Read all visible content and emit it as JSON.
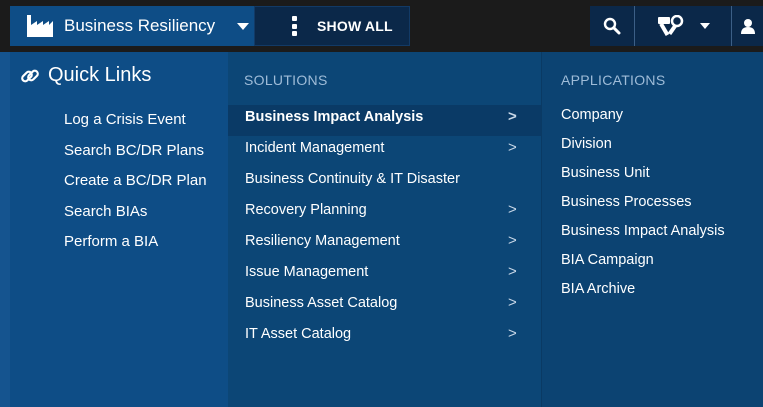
{
  "header": {
    "workspace_title": "Business Resiliency",
    "show_all_label": "SHOW ALL"
  },
  "quick_links": {
    "title": "Quick Links",
    "items": [
      {
        "label": "Log a Crisis Event"
      },
      {
        "label": "Search BC/DR Plans"
      },
      {
        "label": "Create a BC/DR Plan"
      },
      {
        "label": "Search BIAs"
      },
      {
        "label": "Perform a BIA"
      }
    ]
  },
  "solutions": {
    "heading": "SOLUTIONS",
    "items": [
      {
        "label": "Business Impact Analysis",
        "has_submenu": true,
        "active": true
      },
      {
        "label": "Incident Management",
        "has_submenu": true
      },
      {
        "label": "Business Continuity & IT Disaster",
        "has_submenu": false
      },
      {
        "label": "Recovery Planning",
        "has_submenu": true
      },
      {
        "label": "Resiliency Management",
        "has_submenu": true
      },
      {
        "label": "Issue Management",
        "has_submenu": true
      },
      {
        "label": "Business Asset Catalog",
        "has_submenu": true
      },
      {
        "label": "IT Asset Catalog",
        "has_submenu": true
      }
    ],
    "chevron": ">"
  },
  "applications": {
    "heading": "APPLICATIONS",
    "items": [
      {
        "label": "Company"
      },
      {
        "label": "Division"
      },
      {
        "label": "Business Unit"
      },
      {
        "label": "Business Processes"
      },
      {
        "label": "Business Impact Analysis"
      },
      {
        "label": "BIA Campaign"
      },
      {
        "label": "BIA Archive"
      }
    ]
  },
  "colors": {
    "workspace_bg": "#0e4d86",
    "menu_bg": "#0c4676",
    "active_row": "#0a3a66",
    "topbar_bg": "#1b1b1b"
  },
  "icons": [
    "factory-icon",
    "chevron-down-icon",
    "vertical-dots-icon",
    "search-icon",
    "tools-icon",
    "user-icon",
    "link-icon",
    "chevron-right-icon"
  ]
}
